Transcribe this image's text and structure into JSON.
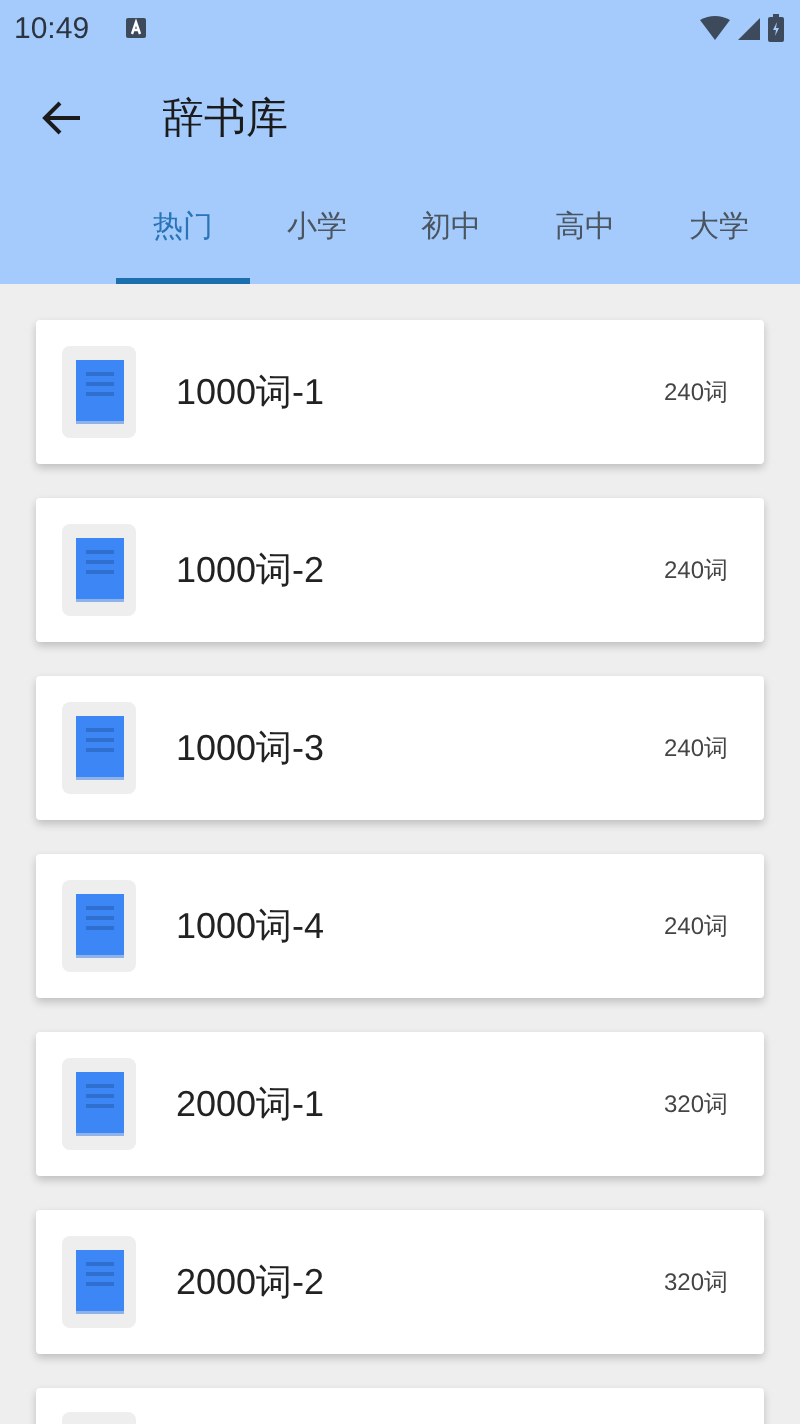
{
  "status_bar": {
    "time": "10:49"
  },
  "toolbar": {
    "title": "辞书库"
  },
  "tabs": [
    {
      "label": "热门",
      "selected": true
    },
    {
      "label": "小学",
      "selected": false
    },
    {
      "label": "初中",
      "selected": false
    },
    {
      "label": "高中",
      "selected": false
    },
    {
      "label": "大学",
      "selected": false
    }
  ],
  "books": [
    {
      "title": "1000词-1",
      "count": "240词"
    },
    {
      "title": "1000词-2",
      "count": "240词"
    },
    {
      "title": "1000词-3",
      "count": "240词"
    },
    {
      "title": "1000词-4",
      "count": "240词"
    },
    {
      "title": "2000词-1",
      "count": "320词"
    },
    {
      "title": "2000词-2",
      "count": "320词"
    }
  ]
}
